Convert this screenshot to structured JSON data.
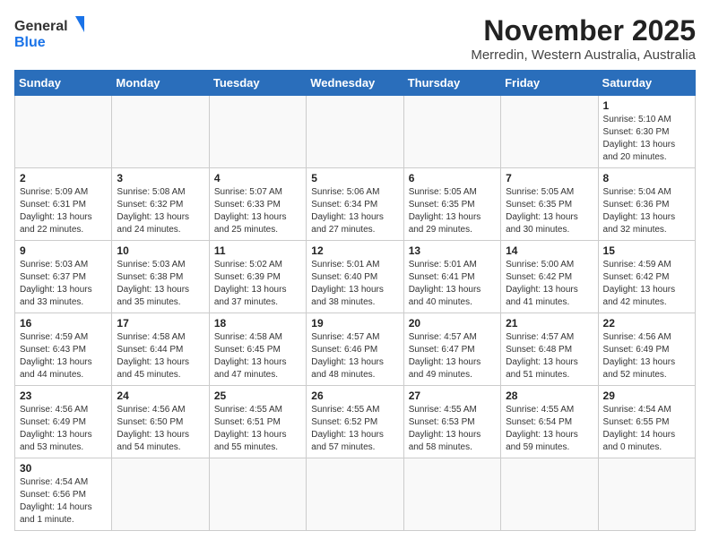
{
  "header": {
    "logo_line1": "General",
    "logo_line2": "Blue",
    "month": "November 2025",
    "location": "Merredin, Western Australia, Australia"
  },
  "weekdays": [
    "Sunday",
    "Monday",
    "Tuesday",
    "Wednesday",
    "Thursday",
    "Friday",
    "Saturday"
  ],
  "weeks": [
    [
      {
        "day": "",
        "info": ""
      },
      {
        "day": "",
        "info": ""
      },
      {
        "day": "",
        "info": ""
      },
      {
        "day": "",
        "info": ""
      },
      {
        "day": "",
        "info": ""
      },
      {
        "day": "",
        "info": ""
      },
      {
        "day": "1",
        "info": "Sunrise: 5:10 AM\nSunset: 6:30 PM\nDaylight: 13 hours and 20 minutes."
      }
    ],
    [
      {
        "day": "2",
        "info": "Sunrise: 5:09 AM\nSunset: 6:31 PM\nDaylight: 13 hours and 22 minutes."
      },
      {
        "day": "3",
        "info": "Sunrise: 5:08 AM\nSunset: 6:32 PM\nDaylight: 13 hours and 24 minutes."
      },
      {
        "day": "4",
        "info": "Sunrise: 5:07 AM\nSunset: 6:33 PM\nDaylight: 13 hours and 25 minutes."
      },
      {
        "day": "5",
        "info": "Sunrise: 5:06 AM\nSunset: 6:34 PM\nDaylight: 13 hours and 27 minutes."
      },
      {
        "day": "6",
        "info": "Sunrise: 5:05 AM\nSunset: 6:35 PM\nDaylight: 13 hours and 29 minutes."
      },
      {
        "day": "7",
        "info": "Sunrise: 5:05 AM\nSunset: 6:35 PM\nDaylight: 13 hours and 30 minutes."
      },
      {
        "day": "8",
        "info": "Sunrise: 5:04 AM\nSunset: 6:36 PM\nDaylight: 13 hours and 32 minutes."
      }
    ],
    [
      {
        "day": "9",
        "info": "Sunrise: 5:03 AM\nSunset: 6:37 PM\nDaylight: 13 hours and 33 minutes."
      },
      {
        "day": "10",
        "info": "Sunrise: 5:03 AM\nSunset: 6:38 PM\nDaylight: 13 hours and 35 minutes."
      },
      {
        "day": "11",
        "info": "Sunrise: 5:02 AM\nSunset: 6:39 PM\nDaylight: 13 hours and 37 minutes."
      },
      {
        "day": "12",
        "info": "Sunrise: 5:01 AM\nSunset: 6:40 PM\nDaylight: 13 hours and 38 minutes."
      },
      {
        "day": "13",
        "info": "Sunrise: 5:01 AM\nSunset: 6:41 PM\nDaylight: 13 hours and 40 minutes."
      },
      {
        "day": "14",
        "info": "Sunrise: 5:00 AM\nSunset: 6:42 PM\nDaylight: 13 hours and 41 minutes."
      },
      {
        "day": "15",
        "info": "Sunrise: 4:59 AM\nSunset: 6:42 PM\nDaylight: 13 hours and 42 minutes."
      }
    ],
    [
      {
        "day": "16",
        "info": "Sunrise: 4:59 AM\nSunset: 6:43 PM\nDaylight: 13 hours and 44 minutes."
      },
      {
        "day": "17",
        "info": "Sunrise: 4:58 AM\nSunset: 6:44 PM\nDaylight: 13 hours and 45 minutes."
      },
      {
        "day": "18",
        "info": "Sunrise: 4:58 AM\nSunset: 6:45 PM\nDaylight: 13 hours and 47 minutes."
      },
      {
        "day": "19",
        "info": "Sunrise: 4:57 AM\nSunset: 6:46 PM\nDaylight: 13 hours and 48 minutes."
      },
      {
        "day": "20",
        "info": "Sunrise: 4:57 AM\nSunset: 6:47 PM\nDaylight: 13 hours and 49 minutes."
      },
      {
        "day": "21",
        "info": "Sunrise: 4:57 AM\nSunset: 6:48 PM\nDaylight: 13 hours and 51 minutes."
      },
      {
        "day": "22",
        "info": "Sunrise: 4:56 AM\nSunset: 6:49 PM\nDaylight: 13 hours and 52 minutes."
      }
    ],
    [
      {
        "day": "23",
        "info": "Sunrise: 4:56 AM\nSunset: 6:49 PM\nDaylight: 13 hours and 53 minutes."
      },
      {
        "day": "24",
        "info": "Sunrise: 4:56 AM\nSunset: 6:50 PM\nDaylight: 13 hours and 54 minutes."
      },
      {
        "day": "25",
        "info": "Sunrise: 4:55 AM\nSunset: 6:51 PM\nDaylight: 13 hours and 55 minutes."
      },
      {
        "day": "26",
        "info": "Sunrise: 4:55 AM\nSunset: 6:52 PM\nDaylight: 13 hours and 57 minutes."
      },
      {
        "day": "27",
        "info": "Sunrise: 4:55 AM\nSunset: 6:53 PM\nDaylight: 13 hours and 58 minutes."
      },
      {
        "day": "28",
        "info": "Sunrise: 4:55 AM\nSunset: 6:54 PM\nDaylight: 13 hours and 59 minutes."
      },
      {
        "day": "29",
        "info": "Sunrise: 4:54 AM\nSunset: 6:55 PM\nDaylight: 14 hours and 0 minutes."
      }
    ],
    [
      {
        "day": "30",
        "info": "Sunrise: 4:54 AM\nSunset: 6:56 PM\nDaylight: 14 hours and 1 minute."
      },
      {
        "day": "",
        "info": ""
      },
      {
        "day": "",
        "info": ""
      },
      {
        "day": "",
        "info": ""
      },
      {
        "day": "",
        "info": ""
      },
      {
        "day": "",
        "info": ""
      },
      {
        "day": "",
        "info": ""
      }
    ]
  ]
}
